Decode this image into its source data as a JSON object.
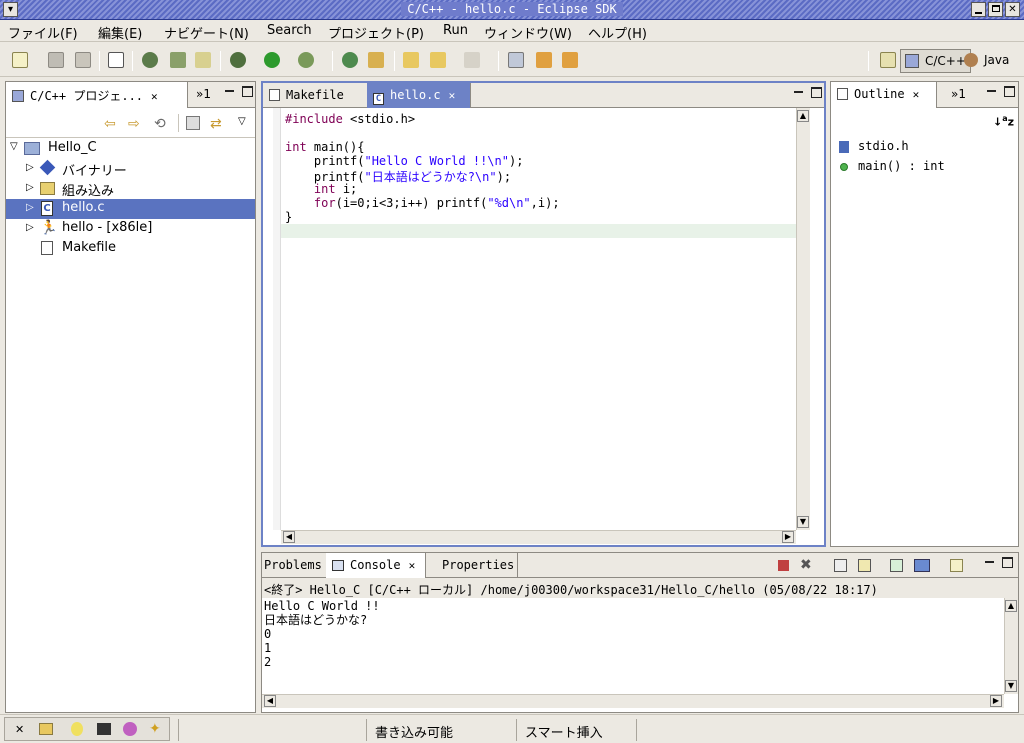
{
  "window": {
    "title": "C/C++ - hello.c - Eclipse SDK",
    "menu_icon": "chevron-down-icon",
    "controls": [
      "minimize-icon",
      "maximize-icon",
      "close-icon"
    ]
  },
  "menu": [
    {
      "label": "ファイル(F)"
    },
    {
      "label": "編集(E)"
    },
    {
      "label": "ナビゲート(N)"
    },
    {
      "label": "Search"
    },
    {
      "label": "プロジェクト(P)"
    },
    {
      "label": "Run"
    },
    {
      "label": "ウィンドウ(W)"
    },
    {
      "label": "ヘルプ(H)"
    }
  ],
  "perspectives": [
    {
      "label": "C/C++",
      "selected": true
    },
    {
      "label": "Java",
      "selected": false
    }
  ],
  "project_explorer": {
    "tab_label": "C/C++ プロジェ...",
    "overflow_label": "»1",
    "items": [
      {
        "label": "Hello_C",
        "level": 0,
        "expanded": true,
        "icon": "project-folder-icon"
      },
      {
        "label": "バイナリー",
        "level": 1,
        "icon": "binary-diamond-icon"
      },
      {
        "label": "組み込み",
        "level": 1,
        "icon": "include-folder-icon"
      },
      {
        "label": "hello.c",
        "level": 1,
        "icon": "c-file-icon",
        "selected": true
      },
      {
        "label": "hello - [x86le]",
        "level": 1,
        "icon": "executable-icon"
      },
      {
        "label": "Makefile",
        "level": 1,
        "icon": "makefile-icon"
      }
    ]
  },
  "editor": {
    "tabs": [
      {
        "label": "Makefile",
        "active": false
      },
      {
        "label": "hello.c",
        "active": true
      }
    ],
    "lines": [
      "#include <stdio.h>",
      "",
      "int main(){",
      "    printf(\"Hello C World !!\\n\");",
      "    printf(\"日本語はどうかな?\\n\");",
      "    int i;",
      "    for(i=0;i<3;i++) printf(\"%d\\n\",i);",
      "}"
    ]
  },
  "outline": {
    "tab_label": "Outline",
    "overflow_label": "»1",
    "items": [
      {
        "label": "stdio.h",
        "icon": "include-icon"
      },
      {
        "label": "main() : int",
        "icon": "function-dot-icon"
      }
    ]
  },
  "bottom": {
    "tabs": [
      {
        "label": "Problems",
        "active": false
      },
      {
        "label": "Console",
        "active": true
      },
      {
        "label": "Properties",
        "active": false
      }
    ],
    "console_header": "<終了> Hello_C [C/C++ ローカル] /home/j00300/workspace31/Hello_C/hello (05/08/22 18:17)",
    "console_lines": [
      "Hello C World !!",
      "日本語はどうかな?",
      "0",
      "1",
      "2"
    ]
  },
  "status": {
    "writable": "書き込み可能",
    "insert_mode": "スマート挿入"
  },
  "colors": {
    "selection": "#5a73c0",
    "keyword": "#7f0055",
    "string": "#2a00ff",
    "current_line": "#e8f2e8"
  }
}
